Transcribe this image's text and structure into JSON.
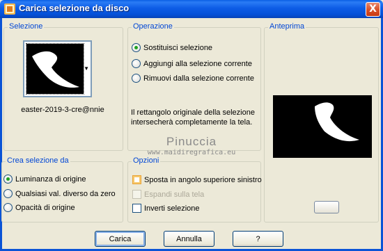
{
  "window": {
    "title": "Carica selezione da disco",
    "close_glyph": "X"
  },
  "selezione": {
    "label": "Selezione",
    "file_name": "easter-2019-3-cre@nnie"
  },
  "operazione": {
    "label": "Operazione",
    "options": [
      {
        "label": "Sostituisci selezione",
        "checked": true
      },
      {
        "label": "Aggiungi alla selezione corrente",
        "checked": false
      },
      {
        "label": "Rimuovi dalla selezione corrente",
        "checked": false
      }
    ],
    "note": "Il rettangolo originale della selezione intersecherà completamente la tela."
  },
  "anteprima": {
    "label": "Anteprima"
  },
  "crea": {
    "label": "Crea selezione da",
    "options": [
      {
        "label": "Luminanza di origine",
        "checked": true
      },
      {
        "label": "Qualsiasi val. diverso da zero",
        "checked": false
      },
      {
        "label": "Opacità di origine",
        "checked": false
      }
    ]
  },
  "opzioni": {
    "label": "Opzioni",
    "items": [
      {
        "label": "Sposta in angolo superiore sinistro",
        "checked": false,
        "enabled": true
      },
      {
        "label": "Espandi sulla tela",
        "checked": false,
        "enabled": false
      },
      {
        "label": "Inverti selezione",
        "checked": false,
        "enabled": true
      }
    ]
  },
  "buttons": {
    "ok": "Carica",
    "cancel": "Annulla",
    "help": "?"
  },
  "watermark": {
    "line1": "Pinuccia",
    "line2": "www.maidiregrafica.eu"
  }
}
